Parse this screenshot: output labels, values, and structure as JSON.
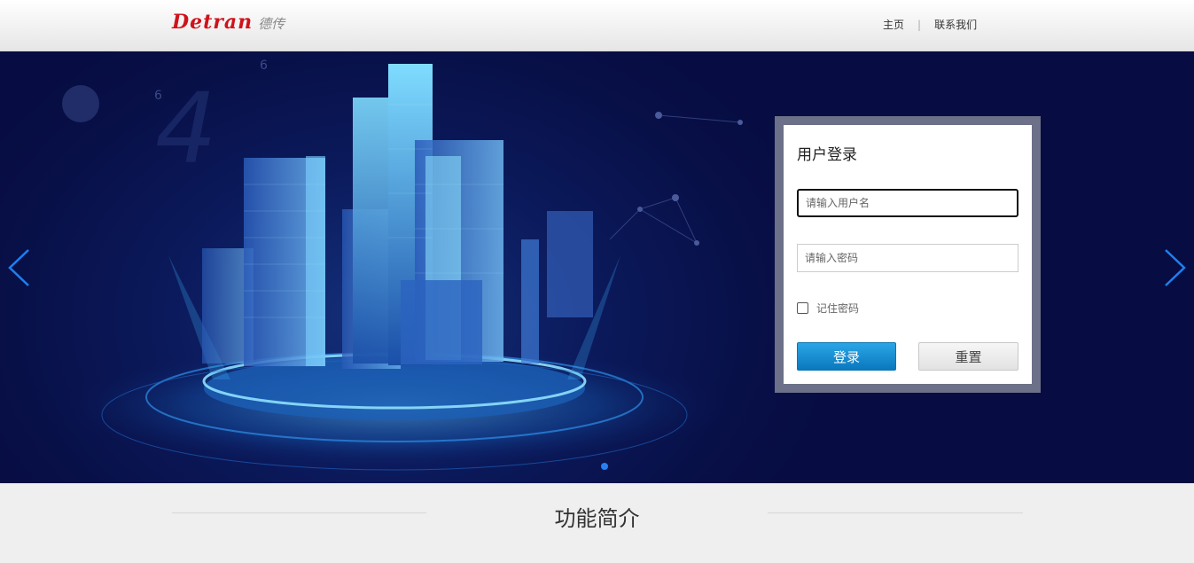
{
  "header": {
    "logo_en": "Detran",
    "logo_cn": "德传",
    "nav": [
      {
        "label": "主页"
      },
      {
        "label": "联系我们"
      }
    ],
    "nav_separator": "|"
  },
  "banner": {
    "slide_count": 1,
    "active_slide": 1,
    "accent_color": "#2a7ff0",
    "background_color": "#081048"
  },
  "login": {
    "title": "用户登录",
    "username_placeholder": "请输入用户名",
    "password_placeholder": "请输入密码",
    "remember_label": "记住密码",
    "remember_checked": false,
    "login_label": "登录",
    "reset_label": "重置"
  },
  "features": {
    "title": "功能简介"
  }
}
